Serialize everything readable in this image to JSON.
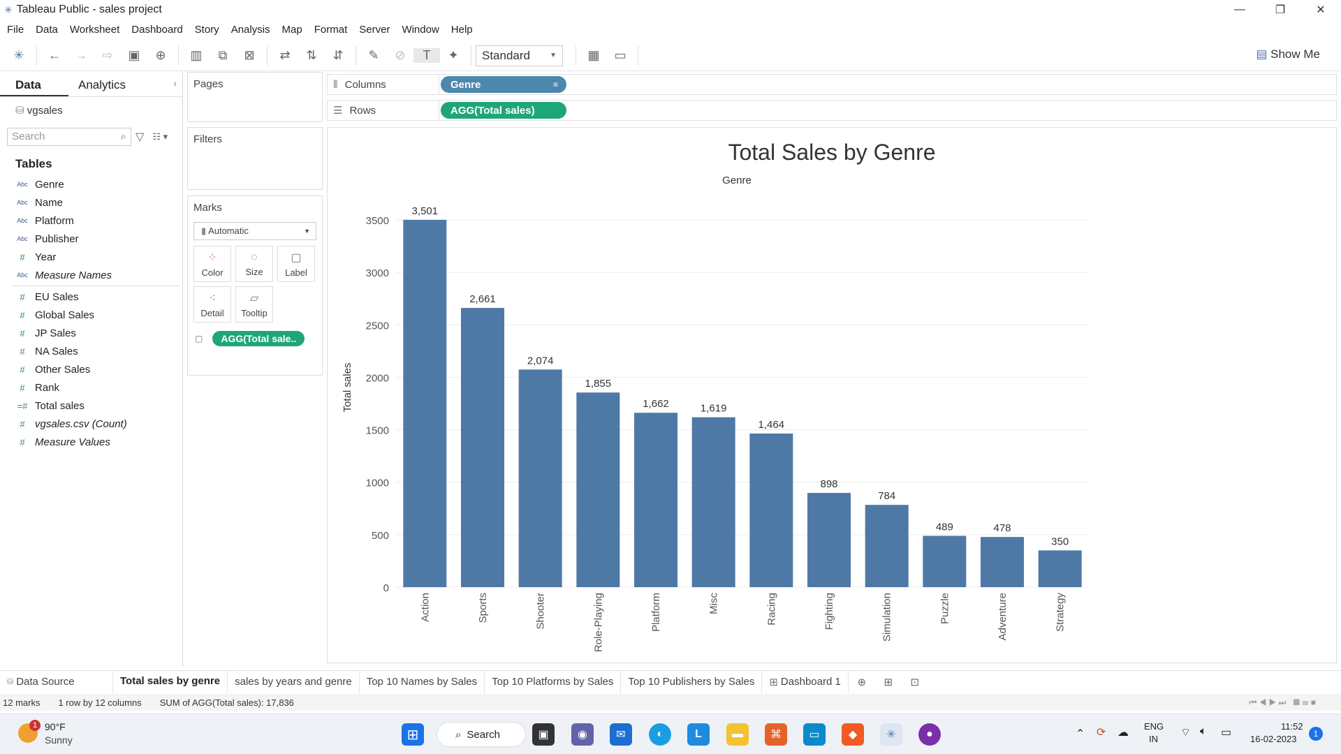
{
  "window": {
    "title": "Tableau Public - sales project",
    "minimize": "—",
    "maximize": "❐",
    "close": "✕"
  },
  "menu": [
    "File",
    "Data",
    "Worksheet",
    "Dashboard",
    "Story",
    "Analysis",
    "Map",
    "Format",
    "Server",
    "Window",
    "Help"
  ],
  "toolbar": {
    "fit": "Standard",
    "show_me": "Show Me"
  },
  "left": {
    "tab_data": "Data",
    "tab_analytics": "Analytics",
    "datasource": "vgsales",
    "search_placeholder": "Search",
    "tables_heading": "Tables",
    "dims": [
      {
        "name": "Genre",
        "icon": "Abc"
      },
      {
        "name": "Name",
        "icon": "Abc"
      },
      {
        "name": "Platform",
        "icon": "Abc"
      },
      {
        "name": "Publisher",
        "icon": "Abc"
      },
      {
        "name": "Year",
        "icon": "#"
      },
      {
        "name": "Measure Names",
        "icon": "Abc"
      }
    ],
    "measures": [
      {
        "name": "EU Sales",
        "icon": "#"
      },
      {
        "name": "Global Sales",
        "icon": "#"
      },
      {
        "name": "JP Sales",
        "icon": "#"
      },
      {
        "name": "NA Sales",
        "icon": "#"
      },
      {
        "name": "Other Sales",
        "icon": "#"
      },
      {
        "name": "Rank",
        "icon": "#"
      },
      {
        "name": "Total sales",
        "icon": "=#"
      },
      {
        "name": "vgsales.csv (Count)",
        "icon": "#"
      },
      {
        "name": "Measure Values",
        "icon": "#"
      }
    ]
  },
  "cards": {
    "pages": "Pages",
    "filters": "Filters",
    "marks": "Marks",
    "mark_type": "Automatic",
    "buttons": [
      "Color",
      "Size",
      "Label",
      "Detail",
      "Tooltip"
    ],
    "mark_pill": "AGG(Total sale.."
  },
  "shelves": {
    "columns_label": "Columns",
    "columns_pill": "Genre",
    "rows_label": "Rows",
    "rows_pill": "AGG(Total sales)"
  },
  "chart_data": {
    "type": "bar",
    "title": "Total Sales by Genre",
    "xlabel": "Genre",
    "ylabel": "Total sales",
    "categories": [
      "Action",
      "Sports",
      "Shooter",
      "Role-Playing",
      "Platform",
      "Misc",
      "Racing",
      "Fighting",
      "Simulation",
      "Puzzle",
      "Adventure",
      "Strategy"
    ],
    "values": [
      3501,
      2661,
      2074,
      1855,
      1662,
      1619,
      1464,
      898,
      784,
      489,
      478,
      350
    ],
    "data_labels": [
      "3,501",
      "2,661",
      "2,074",
      "1,855",
      "1,662",
      "1,619",
      "1,464",
      "898",
      "784",
      "489",
      "478",
      "350"
    ],
    "yticks": [
      0,
      500,
      1000,
      1500,
      2000,
      2500,
      3000,
      3500
    ],
    "ylim": [
      0,
      3500
    ],
    "bar_color": "#4e79a7",
    "grid": true
  },
  "sheets": [
    "Data Source",
    "Total sales by genre",
    "sales by years and genre",
    "Top 10 Names by Sales",
    "Top 10 Platforms by Sales",
    "Top 10 Publishers by Sales",
    "Dashboard 1"
  ],
  "status": {
    "marks": "12 marks",
    "dims": "1 row by 12 columns",
    "sum": "SUM of AGG(Total sales): 17,836"
  },
  "taskbar": {
    "temp": "90°F",
    "weather": "Sunny",
    "weather_badge": "1",
    "search": "Search",
    "lang1": "ENG",
    "lang2": "IN",
    "time": "11:52",
    "date": "16-02-2023",
    "notif": "1"
  }
}
